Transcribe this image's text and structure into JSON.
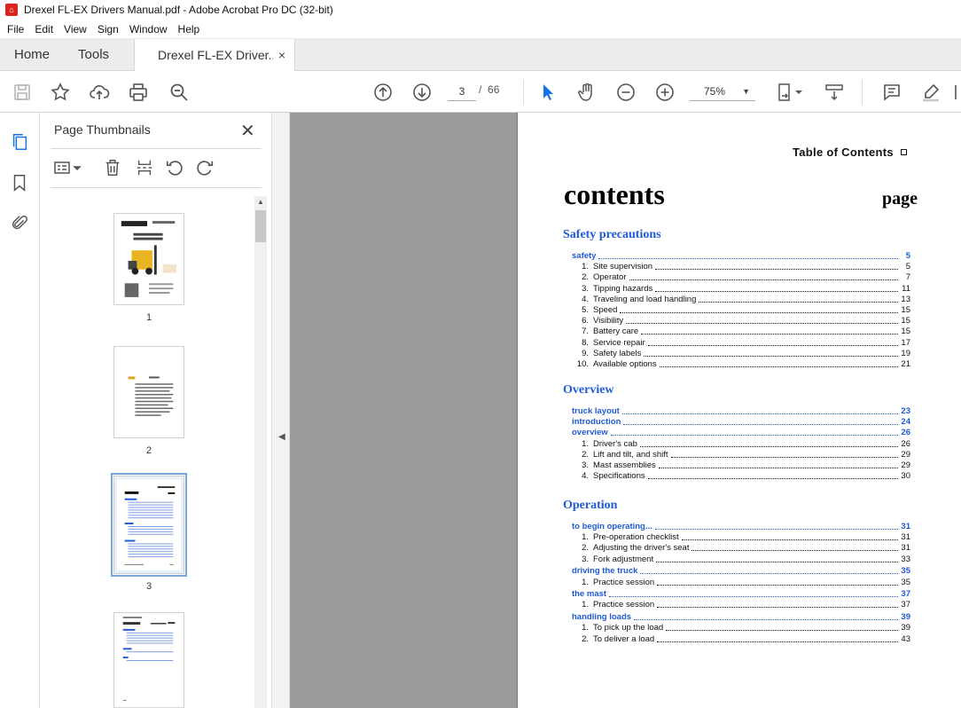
{
  "window": {
    "title": "Drexel FL-EX Drivers Manual.pdf - Adobe Acrobat Pro DC (32-bit)"
  },
  "menu": [
    "File",
    "Edit",
    "View",
    "Sign",
    "Window",
    "Help"
  ],
  "tabs": {
    "home": "Home",
    "tools": "Tools",
    "document": "Drexel FL-EX Driver...",
    "close": "×"
  },
  "toolbar": {
    "current_page": "3",
    "page_separator": "/",
    "total_pages": "66",
    "zoom": "75%"
  },
  "thumbnail_panel": {
    "title": "Page Thumbnails",
    "close": "✕",
    "thumbnails": [
      {
        "label": "1",
        "selected": false
      },
      {
        "label": "2",
        "selected": false
      },
      {
        "label": "3",
        "selected": true
      },
      {
        "label": "",
        "selected": false
      }
    ]
  },
  "document_page": {
    "header": "Table of Contents",
    "title": "contents",
    "page_heading": "page",
    "sections": [
      {
        "title": "Safety precautions",
        "entries": [
          {
            "type": "main",
            "label": "safety",
            "page": "5"
          },
          {
            "type": "sub",
            "num": "1.",
            "label": "Site supervision",
            "page": "5"
          },
          {
            "type": "sub",
            "num": "2.",
            "label": "Operator",
            "page": "7"
          },
          {
            "type": "sub",
            "num": "3.",
            "label": "Tipping hazards",
            "page": "11"
          },
          {
            "type": "sub",
            "num": "4.",
            "label": "Traveling and load handling",
            "page": "13"
          },
          {
            "type": "sub",
            "num": "5.",
            "label": "Speed",
            "page": "15"
          },
          {
            "type": "sub",
            "num": "6.",
            "label": "Visibility",
            "page": "15"
          },
          {
            "type": "sub",
            "num": "7.",
            "label": "Battery care",
            "page": "15"
          },
          {
            "type": "sub",
            "num": "8.",
            "label": "Service repair",
            "page": "17"
          },
          {
            "type": "sub",
            "num": "9.",
            "label": "Safety labels",
            "page": "19"
          },
          {
            "type": "sub",
            "num": "10.",
            "label": "Available options",
            "page": "21"
          }
        ]
      },
      {
        "title": "Overview",
        "entries": [
          {
            "type": "main",
            "label": "truck layout",
            "page": "23"
          },
          {
            "type": "main",
            "label": "introduction",
            "page": "24"
          },
          {
            "type": "main",
            "label": "overview",
            "page": "26"
          },
          {
            "type": "sub",
            "num": "1.",
            "label": "Driver's cab",
            "page": "26"
          },
          {
            "type": "sub",
            "num": "2.",
            "label": "Lift and tilt, and shift",
            "page": "29"
          },
          {
            "type": "sub",
            "num": "3.",
            "label": "Mast assemblies",
            "page": "29"
          },
          {
            "type": "sub",
            "num": "4.",
            "label": "Specifications",
            "page": "30"
          }
        ]
      },
      {
        "title": "Operation",
        "entries": [
          {
            "type": "main",
            "label": "to begin operating...",
            "page": "31"
          },
          {
            "type": "sub",
            "num": "1.",
            "label": "Pre-operation checklist",
            "page": "31"
          },
          {
            "type": "sub",
            "num": "2.",
            "label": "Adjusting the driver's seat",
            "page": "31"
          },
          {
            "type": "sub",
            "num": "3.",
            "label": "Fork adjustment",
            "page": "33"
          },
          {
            "type": "main",
            "label": "driving the truck",
            "page": "35"
          },
          {
            "type": "sub",
            "num": "1.",
            "label": "Practice session",
            "page": "35"
          },
          {
            "type": "main",
            "label": "the mast",
            "page": "37"
          },
          {
            "type": "sub",
            "num": "1.",
            "label": "Practice session",
            "page": "37"
          },
          {
            "type": "main",
            "label": "handling loads",
            "page": "39"
          },
          {
            "type": "sub",
            "num": "1.",
            "label": "To pick up the load",
            "page": "39"
          },
          {
            "type": "sub",
            "num": "2.",
            "label": "To deliver a load",
            "page": "43"
          }
        ]
      }
    ]
  },
  "colors": {
    "link_blue": "#1f5bd2",
    "accent_blue": "#1473e6",
    "canvas_gray": "#9b9b9b"
  }
}
